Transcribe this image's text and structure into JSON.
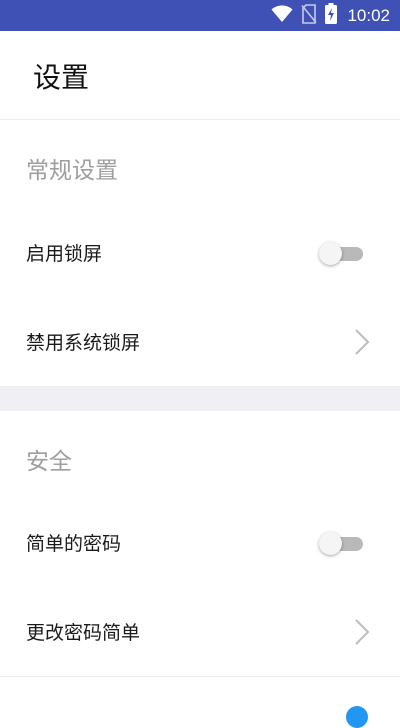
{
  "status_bar": {
    "time": "10:02",
    "icons": [
      "wifi-icon",
      "no-sim-icon",
      "battery-charging-icon"
    ],
    "background": "#3f51b5"
  },
  "app_bar": {
    "title": "设置"
  },
  "sections": [
    {
      "header": "常规设置",
      "items": [
        {
          "label": "启用锁屏",
          "control": "switch",
          "checked": false
        },
        {
          "label": "禁用系统锁屏",
          "control": "chevron"
        }
      ]
    },
    {
      "header": "安全",
      "items": [
        {
          "label": "简单的密码",
          "control": "switch",
          "checked": false
        },
        {
          "label": "更改密码简单",
          "control": "chevron"
        }
      ]
    }
  ],
  "colors": {
    "accent": "#2196f3",
    "section_header_text": "#9e9e9e",
    "divider": "#ececec",
    "section_gap": "#efeff4"
  }
}
